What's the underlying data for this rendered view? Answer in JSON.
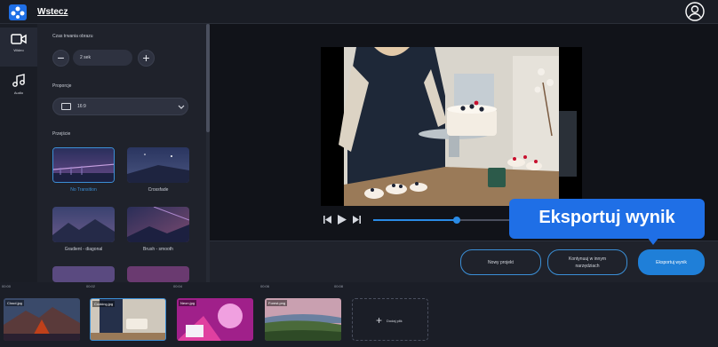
{
  "header": {
    "back_label": "Wstecz",
    "logo_icon": "app-logo-icon",
    "account_icon": "account-circle-icon"
  },
  "rail": {
    "items": [
      {
        "label": "Wideo",
        "icon": "video-camera-icon"
      },
      {
        "label": "Audio",
        "icon": "music-note-icon"
      }
    ]
  },
  "settings": {
    "duration_label": "Czas trwania obrazu",
    "duration_value": "2 sek",
    "proportion_label": "Proporcje",
    "proportion_value": "16:9",
    "transitions_label": "Przejście",
    "transitions": [
      {
        "label": "No Transition",
        "selected": true
      },
      {
        "label": "Crossfade",
        "selected": false
      },
      {
        "label": "Gradient - diagonal",
        "selected": false
      },
      {
        "label": "Brush - smooth",
        "selected": false
      }
    ]
  },
  "player": {
    "progress": 0.4,
    "play_icon": "play-icon",
    "prev_icon": "skip-back-icon",
    "next_icon": "skip-forward-icon"
  },
  "actions": {
    "new_project": "Nowy projekt",
    "continue_other": "Kontynuuj w innym narzędziach",
    "export_result": "Eksportuj wynik"
  },
  "tooltip": {
    "text": "Eksportuj wynik"
  },
  "ruler": {
    "ticks": [
      "00:00",
      "00:02",
      "00:04",
      "00:06",
      "00:08"
    ]
  },
  "timeline": {
    "clips": [
      {
        "name": "Cloud.jpg"
      },
      {
        "name": "Cooking.jpg"
      },
      {
        "name": "Neon.jpg"
      },
      {
        "name": "Forest.png"
      }
    ],
    "add_label": "Dodaj plik"
  },
  "colors": {
    "accent": "#1f7fd8",
    "tooltip_bg": "#1f6fe6",
    "background": "#1b1e27"
  }
}
